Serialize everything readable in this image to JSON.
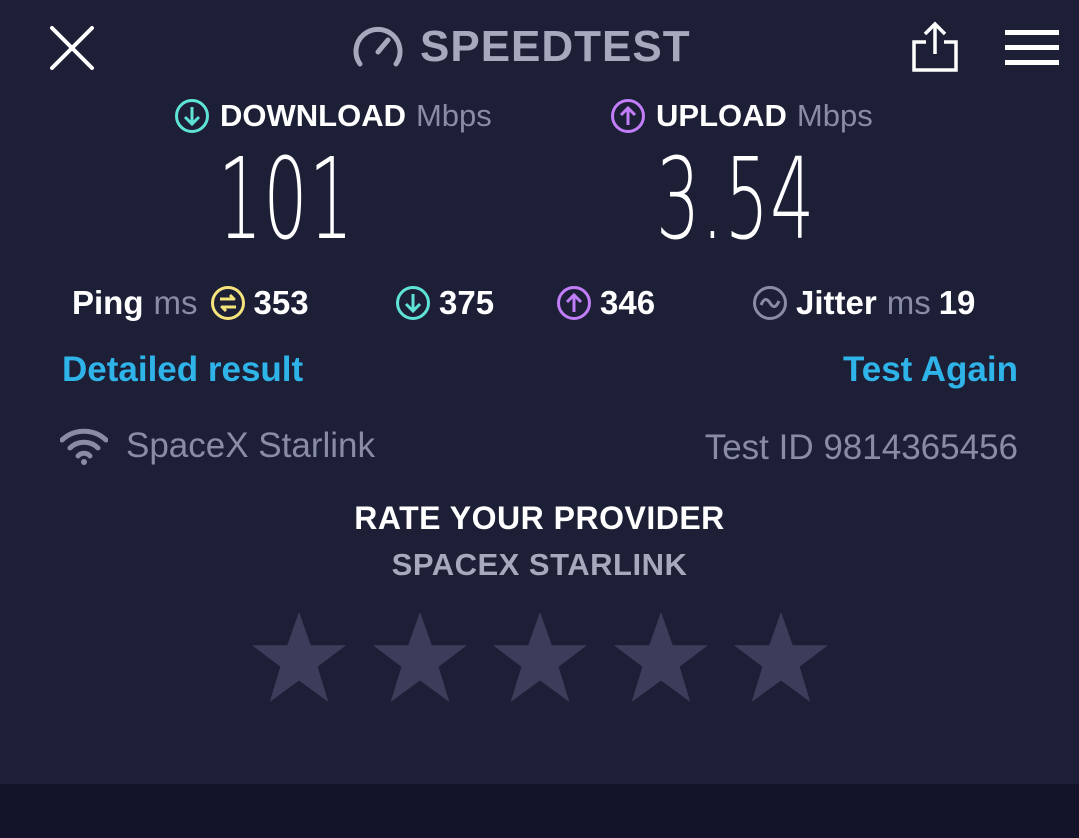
{
  "header": {
    "title": "SPEEDTEST",
    "close_icon": "close-icon",
    "logo_icon": "speedometer-icon",
    "share_icon": "share-icon",
    "menu_icon": "hamburger-menu-icon"
  },
  "download": {
    "label": "DOWNLOAD",
    "unit": "Mbps",
    "value": "101",
    "icon": "arrow-down-circle-icon",
    "color": "#5fe3d6"
  },
  "upload": {
    "label": "UPLOAD",
    "unit": "Mbps",
    "value": "3.54",
    "icon": "arrow-up-circle-icon",
    "color": "#c17ef8"
  },
  "ping": {
    "label": "Ping",
    "unit": "ms",
    "idle": "353",
    "idle_color": "#f4e47b",
    "download": "375",
    "upload": "346"
  },
  "jitter": {
    "label": "Jitter",
    "unit": "ms",
    "value": "19"
  },
  "actions": {
    "detailed": "Detailed result",
    "test_again": "Test Again",
    "link_color": "#2fb4ea"
  },
  "connection": {
    "provider": "SpaceX Starlink",
    "provider_icon": "wifi-icon",
    "test_id": "Test ID 9814365456"
  },
  "rating": {
    "title": "RATE YOUR PROVIDER",
    "provider": "SPACEX STARLINK",
    "stars_total": 5,
    "stars_selected": 0
  }
}
